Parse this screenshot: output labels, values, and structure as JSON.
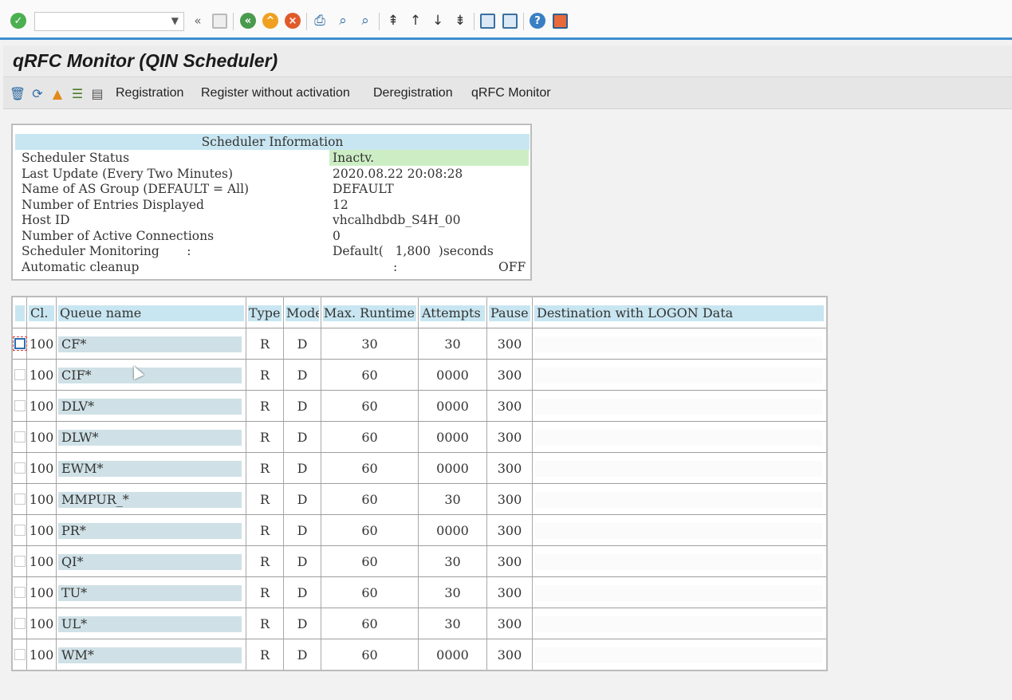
{
  "toolbar": {
    "command_field": "",
    "icons": [
      "enter-icon",
      "back-icon",
      "exit-icon",
      "cancel-icon",
      "print-icon",
      "find-icon",
      "find-next-icon",
      "first-page-icon",
      "previous-page-icon",
      "next-page-icon",
      "last-page-icon",
      "create-session-icon",
      "shortcut-icon",
      "help-icon",
      "customize-layout-icon"
    ]
  },
  "title": "qRFC Monitor (QIN Scheduler)",
  "app_toolbar": {
    "buttons": [
      "Registration",
      "Register without activation",
      "Deregistration",
      "qRFC Monitor"
    ]
  },
  "scheduler_info": {
    "header": "Scheduler Information",
    "rows": [
      {
        "label": "Scheduler Status",
        "value": "Inactv."
      },
      {
        "label": "Last Update (Every Two Minutes)",
        "value": "2020.08.22 20:08:28"
      },
      {
        "label": "Name of AS Group (DEFAULT = All)",
        "value": "DEFAULT"
      },
      {
        "label": "Number of Entries Displayed",
        "value": "12"
      },
      {
        "label": "Host ID",
        "value": "vhcalhdbdb_S4H_00"
      },
      {
        "label": "Number of Active Connections",
        "value": "0"
      },
      {
        "label": "Scheduler Monitoring       :",
        "value": "Default(   1,800  )seconds"
      },
      {
        "label": "Automatic cleanup",
        "colon": ":",
        "value": "OFF"
      }
    ]
  },
  "table": {
    "columns": [
      "Cl.",
      "Queue name",
      "Type",
      "Mode",
      "Max. Runtime",
      "Attempts",
      "Pause",
      "Destination with LOGON Data"
    ],
    "rows": [
      {
        "client": "100",
        "queue": "CF*",
        "type": "R",
        "mode": "D",
        "runtime": "30",
        "attempts": "30",
        "pause": "300",
        "destination": ""
      },
      {
        "client": "100",
        "queue": "CIF*",
        "type": "R",
        "mode": "D",
        "runtime": "60",
        "attempts": "0000",
        "pause": "300",
        "destination": ""
      },
      {
        "client": "100",
        "queue": "DLV*",
        "type": "R",
        "mode": "D",
        "runtime": "60",
        "attempts": "0000",
        "pause": "300",
        "destination": ""
      },
      {
        "client": "100",
        "queue": "DLW*",
        "type": "R",
        "mode": "D",
        "runtime": "60",
        "attempts": "0000",
        "pause": "300",
        "destination": ""
      },
      {
        "client": "100",
        "queue": "EWM*",
        "type": "R",
        "mode": "D",
        "runtime": "60",
        "attempts": "0000",
        "pause": "300",
        "destination": ""
      },
      {
        "client": "100",
        "queue": "MMPUR_*",
        "type": "R",
        "mode": "D",
        "runtime": "60",
        "attempts": "30",
        "pause": "300",
        "destination": ""
      },
      {
        "client": "100",
        "queue": "PR*",
        "type": "R",
        "mode": "D",
        "runtime": "60",
        "attempts": "0000",
        "pause": "300",
        "destination": ""
      },
      {
        "client": "100",
        "queue": "QI*",
        "type": "R",
        "mode": "D",
        "runtime": "60",
        "attempts": "30",
        "pause": "300",
        "destination": ""
      },
      {
        "client": "100",
        "queue": "TU*",
        "type": "R",
        "mode": "D",
        "runtime": "60",
        "attempts": "30",
        "pause": "300",
        "destination": ""
      },
      {
        "client": "100",
        "queue": "UL*",
        "type": "R",
        "mode": "D",
        "runtime": "60",
        "attempts": "30",
        "pause": "300",
        "destination": ""
      },
      {
        "client": "100",
        "queue": "WM*",
        "type": "R",
        "mode": "D",
        "runtime": "60",
        "attempts": "0000",
        "pause": "300",
        "destination": ""
      }
    ]
  },
  "colors": {
    "accent": "#3f8fd0",
    "header_bg": "#c8e6f1",
    "status_bg": "#cdeec4"
  }
}
